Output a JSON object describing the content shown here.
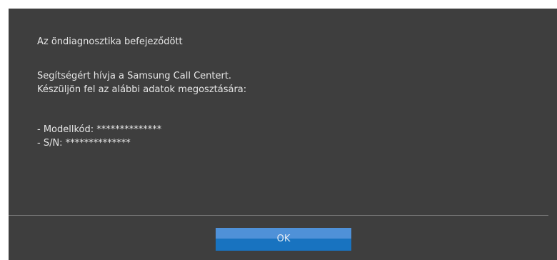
{
  "dialog": {
    "title": "Az öndiagnosztika befejeződött",
    "message_line1": "Segítségért hívja a Samsung Call Centert.",
    "message_line2": "Készüljön fel az alábbi adatok megosztására:",
    "model_code": "- Modellkód: **************",
    "serial_number": "- S/N: **************",
    "ok_label": "OK"
  },
  "colors": {
    "background": "#3e3e3e",
    "text": "#e6e6e6",
    "button": "#1873c0",
    "button_highlight": "#4f91d8"
  }
}
